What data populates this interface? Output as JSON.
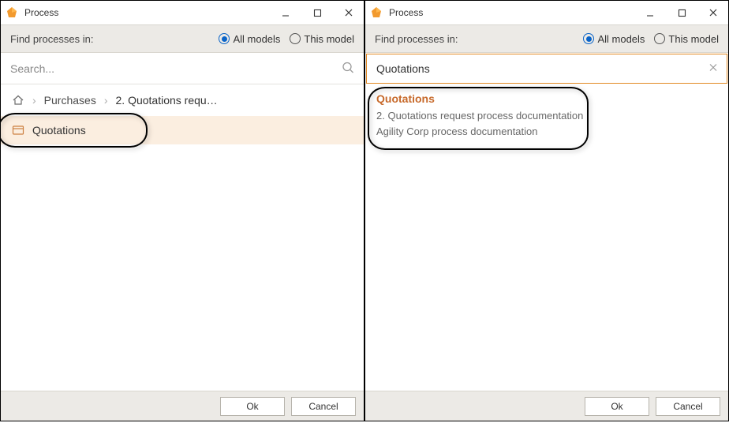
{
  "colors": {
    "accent": "#e28a24",
    "link": "#c7692a",
    "selected_row_bg": "#fbeee0",
    "radio_checked": "#0a64c8"
  },
  "left": {
    "title": "Process",
    "filter_label": "Find processes in:",
    "radio_all": "All models",
    "radio_this": "This model",
    "radio_checked": "all",
    "search_placeholder": "Search...",
    "search_value": "",
    "breadcrumb": {
      "home": "home",
      "items": [
        "Purchases",
        "2. Quotations requ…"
      ]
    },
    "selected_item": "Quotations",
    "footer": {
      "ok": "Ok",
      "cancel": "Cancel"
    }
  },
  "right": {
    "title": "Process",
    "filter_label": "Find processes in:",
    "radio_all": "All models",
    "radio_this": "This model",
    "radio_checked": "all",
    "search_value": "Quotations",
    "suggestion": {
      "title": "Quotations",
      "line1": "2. Quotations request process documentation",
      "line2": "Agility Corp process documentation"
    },
    "footer": {
      "ok": "Ok",
      "cancel": "Cancel"
    }
  }
}
